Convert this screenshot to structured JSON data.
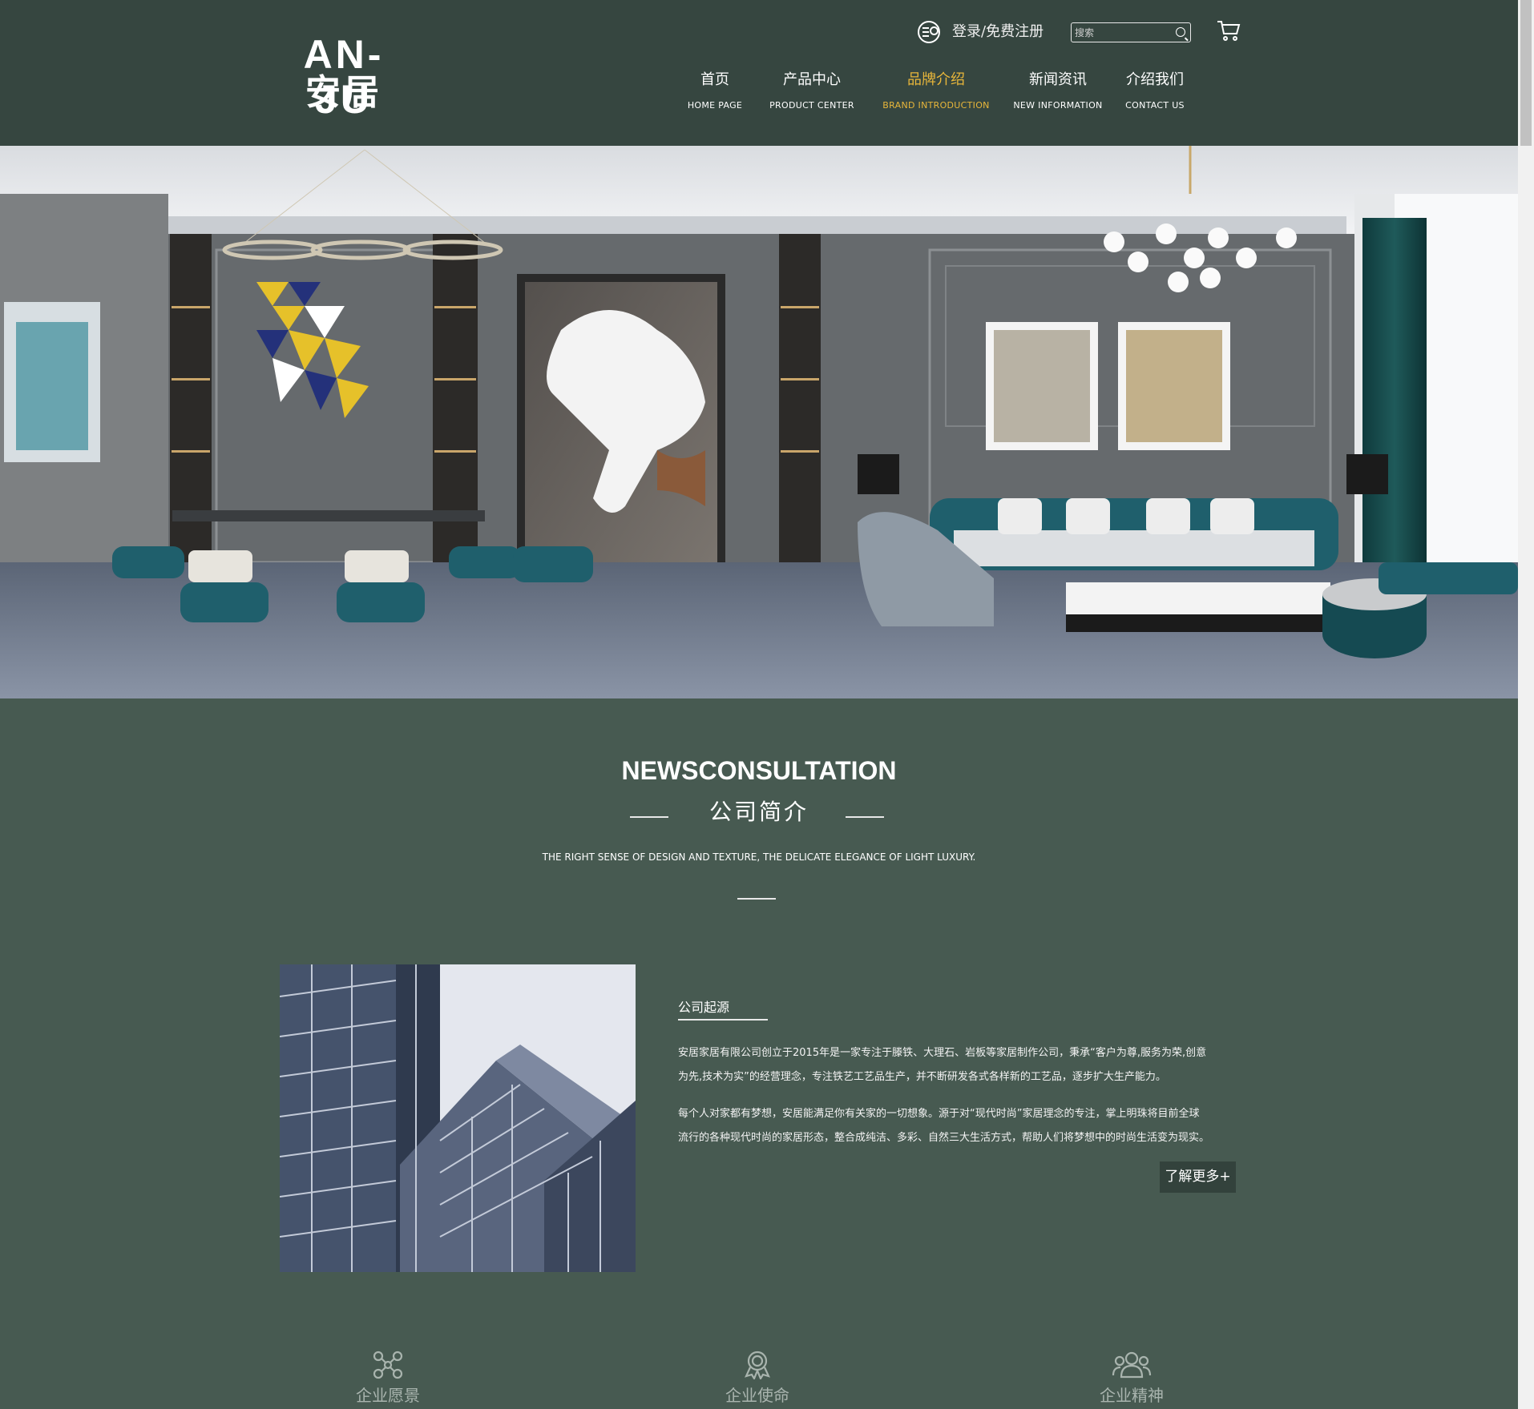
{
  "brand": {
    "logo_en": "AN-JU",
    "logo_cn": "安居"
  },
  "header": {
    "login_label": "登录/免费注册",
    "search_placeholder": "搜索"
  },
  "nav": [
    {
      "cn": "首页",
      "en": "HOME   PAGE",
      "active": false
    },
    {
      "cn": "产品中心",
      "en": "PRODUCT   CENTER",
      "active": false
    },
    {
      "cn": "品牌介绍",
      "en": "BRAND   INTRODUCTION",
      "active": true
    },
    {
      "cn": "新闻资讯",
      "en": "NEW   INFORMATION",
      "active": false
    },
    {
      "cn": "介绍我们",
      "en": "CONTACT   US",
      "active": false
    }
  ],
  "section": {
    "title_en": "NEWSCONSULTATION",
    "title_cn": "公司简介",
    "subtitle": "THE RIGHT SENSE OF DESIGN AND TEXTURE, THE DELICATE ELEGANCE OF LIGHT LUXURY."
  },
  "intro": {
    "origin_title": "公司起源",
    "para1_line1": "安居家居有限公司创立于2015年是一家专注于滕铁、大理石、岩板等家居制作公司，秉承“客户为尊,服务为荣,创意",
    "para1_line2": "为先,技术为实”的经营理念，专注铁艺工艺品生产，并不断研发各式各样新的工艺品，逐步扩大生产能力。",
    "para2_line1": "每个人对家都有梦想，安居能满足你有关家的一切想象。源于对“现代时尚”家居理念的专注，掌上明珠将目前全球",
    "para2_line2": "流行的各种现代时尚的家居形态，整合成纯洁、多彩、自然三大生活方式，帮助人们将梦想中的时尚生活变为现实。",
    "more_label": "了解更多+"
  },
  "values": [
    {
      "label": "企业愿景",
      "icon": "network-icon"
    },
    {
      "label": "企业使命",
      "icon": "award-icon"
    },
    {
      "label": "企业精神",
      "icon": "team-icon"
    }
  ],
  "colors": {
    "header_bg": "#364640",
    "page_bg": "#475a51",
    "accent": "#e8b63a",
    "button_bg": "#33423c"
  }
}
